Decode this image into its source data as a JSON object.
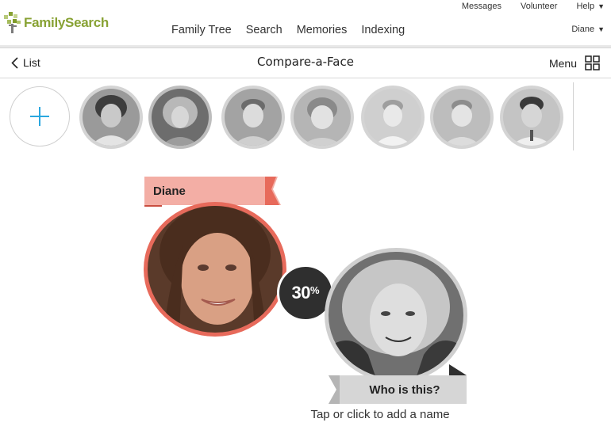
{
  "top_nav": {
    "messages": "Messages",
    "volunteer": "Volunteer",
    "help": "Help"
  },
  "brand": {
    "name": "FamilySearch",
    "color": "#88a234",
    "icon": "family-tree-logo-icon"
  },
  "main_nav": [
    {
      "label": "Family Tree"
    },
    {
      "label": "Search"
    },
    {
      "label": "Memories"
    },
    {
      "label": "Indexing"
    }
  ],
  "user": {
    "name": "Diane"
  },
  "title_bar": {
    "back_label": "List",
    "title": "Compare-a-Face",
    "menu_label": "Menu",
    "menu_icon": "grid-icon"
  },
  "strip": {
    "add_icon": "plus-icon",
    "add_color": "#2aa7df",
    "thumbnails": [
      {
        "selected": false
      },
      {
        "selected": true
      },
      {
        "selected": false
      },
      {
        "selected": false
      },
      {
        "selected": false
      },
      {
        "selected": false
      },
      {
        "selected": false
      }
    ]
  },
  "compare": {
    "person_name": "Diane",
    "person_color": "#e76a5b",
    "banner_color": "#f3aea5",
    "match_percent": "30",
    "percent_symbol": "%",
    "unknown_label": "Who is this?",
    "hint": "Tap or click to add a name"
  }
}
